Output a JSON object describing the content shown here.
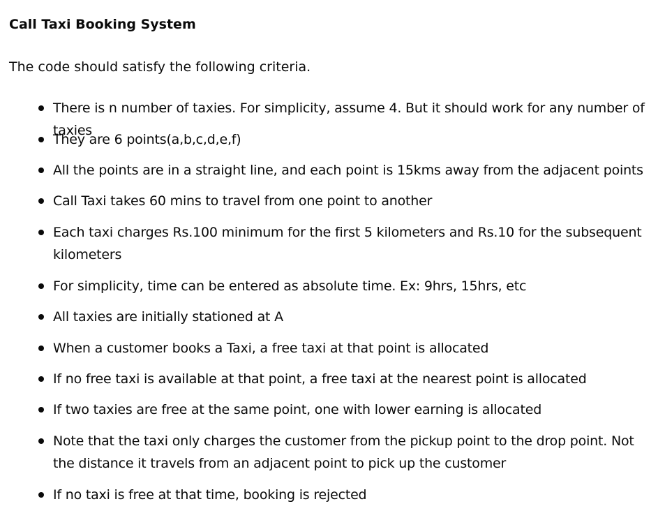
{
  "document": {
    "title": "Call Taxi Booking System",
    "intro": "The code should satisfy the following criteria.",
    "criteria": [
      "There is n number of taxies. For simplicity, assume 4. But it should work for any number of taxies",
      "They are 6 points(a,b,c,d,e,f)",
      "All the points are in a straight line, and each point is 15kms away from the adjacent points",
      "Call Taxi takes 60 mins to travel from one point to another",
      "Each taxi charges Rs.100 minimum for the first 5 kilometers and Rs.10 for the subsequent kilometers",
      "For simplicity, time can be entered as absolute time. Ex: 9hrs, 15hrs, etc",
      "All taxies are initially stationed at A",
      "When a customer books a Taxi, a free taxi at that point is allocated",
      "If no free taxi is available at that point, a free taxi at the nearest point is allocated",
      "If two taxies are free at the same point, one with lower earning is allocated",
      "Note that the taxi only charges the customer from the pickup point to the drop point. Not the distance it travels from an adjacent point to pick up the customer",
      "If no taxi is free at that time, booking is rejected"
    ]
  }
}
